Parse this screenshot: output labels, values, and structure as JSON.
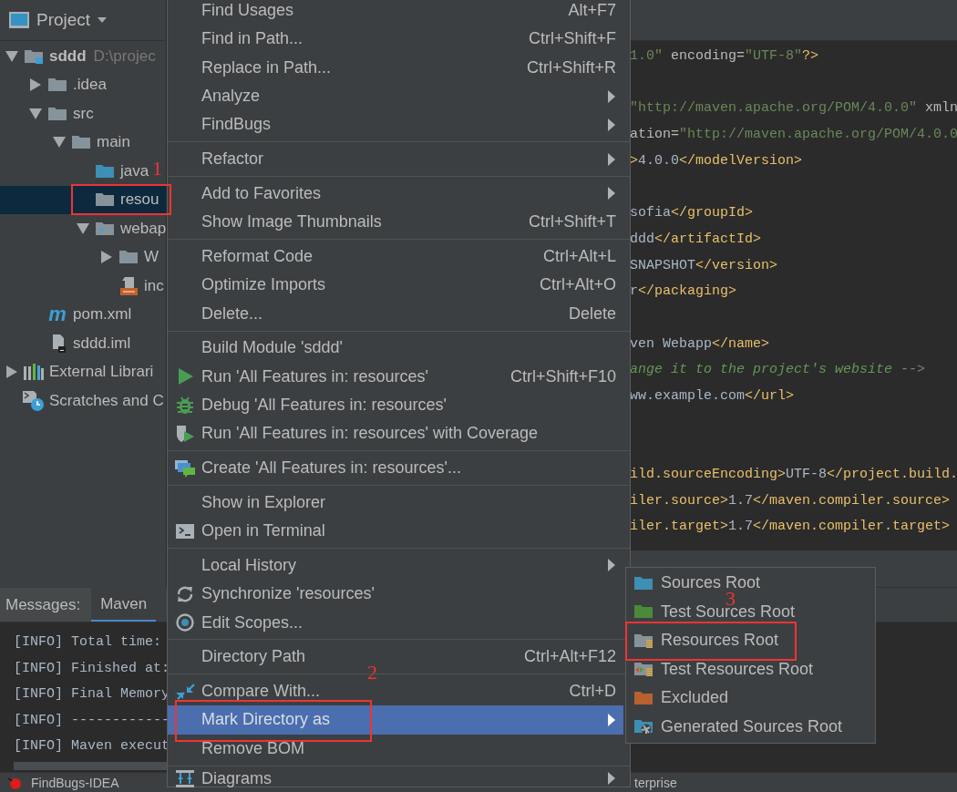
{
  "project_panel": {
    "title": "Project",
    "tree": [
      {
        "label": "sddd",
        "path": "D:\\projec",
        "kind": "module",
        "expanded": true,
        "selected": false,
        "children": [
          {
            "label": ".idea",
            "kind": "folder",
            "expanded": false,
            "selected": false
          },
          {
            "label": "src",
            "kind": "folder",
            "expanded": true,
            "selected": false,
            "children": [
              {
                "label": "main",
                "kind": "folder",
                "expanded": true,
                "selected": false,
                "children": [
                  {
                    "label": "java",
                    "kind": "source-folder",
                    "selected": false
                  },
                  {
                    "label": "resou",
                    "kind": "folder",
                    "selected": true
                  },
                  {
                    "label": "webap",
                    "kind": "web-folder",
                    "expanded": true,
                    "selected": false,
                    "children": [
                      {
                        "label": "W",
                        "kind": "folder",
                        "expanded": false,
                        "selected": false
                      },
                      {
                        "label": "inc",
                        "kind": "jsp",
                        "selected": false
                      }
                    ]
                  }
                ]
              }
            ]
          },
          {
            "label": "pom.xml",
            "kind": "maven",
            "glyph": "m",
            "selected": false
          },
          {
            "label": "sddd.iml",
            "kind": "iml",
            "selected": false
          }
        ]
      },
      {
        "label": "External Librari",
        "kind": "libraries",
        "expanded": false,
        "selected": false
      },
      {
        "label": "Scratches and C",
        "kind": "scratches",
        "selected": false
      }
    ]
  },
  "editor": {
    "lines": [
      {
        "kind": "code",
        "segments": [
          {
            "kind": "string",
            "text": "1.0\""
          },
          {
            "kind": "attr",
            "text": " encoding="
          },
          {
            "kind": "string",
            "text": "\"UTF-8\""
          },
          {
            "kind": "tag",
            "text": "?>"
          }
        ]
      },
      {
        "kind": "blank"
      },
      {
        "kind": "code",
        "segments": [
          {
            "kind": "string",
            "text": "\"http://maven.apache.org/POM/4.0.0\""
          },
          {
            "kind": "attr",
            "text": " xmln"
          }
        ]
      },
      {
        "kind": "code",
        "segments": [
          {
            "kind": "attr",
            "text": "ation="
          },
          {
            "kind": "string",
            "text": "\"http://maven.apache.org/POM/4.0.0"
          }
        ]
      },
      {
        "kind": "code",
        "segments": [
          {
            "kind": "tag",
            "text": ">"
          },
          {
            "kind": "text",
            "text": "4.0.0"
          },
          {
            "kind": "tag",
            "text": "</modelVersion>"
          }
        ]
      },
      {
        "kind": "blank"
      },
      {
        "kind": "code",
        "segments": [
          {
            "kind": "text",
            "text": "sofia"
          },
          {
            "kind": "tag",
            "text": "</groupId>"
          }
        ]
      },
      {
        "kind": "code",
        "segments": [
          {
            "kind": "text",
            "text": "ddd"
          },
          {
            "kind": "tag",
            "text": "</artifactId>"
          }
        ]
      },
      {
        "kind": "code",
        "segments": [
          {
            "kind": "text",
            "text": "SNAPSHOT"
          },
          {
            "kind": "tag",
            "text": "</version>"
          }
        ]
      },
      {
        "kind": "code",
        "segments": [
          {
            "kind": "text",
            "text": "r"
          },
          {
            "kind": "tag",
            "text": "</packaging>"
          }
        ]
      },
      {
        "kind": "blank"
      },
      {
        "kind": "code",
        "segments": [
          {
            "kind": "text",
            "text": "ven Webapp"
          },
          {
            "kind": "tag",
            "text": "</name>"
          }
        ]
      },
      {
        "kind": "code",
        "segments": [
          {
            "kind": "comment",
            "text": "ange it to the project's website"
          },
          {
            "kind": "punct",
            "text": " -->"
          }
        ]
      },
      {
        "kind": "code",
        "segments": [
          {
            "kind": "text",
            "text": "ww.example.com"
          },
          {
            "kind": "tag",
            "text": "</url>"
          }
        ]
      },
      {
        "kind": "blank"
      },
      {
        "kind": "blank"
      },
      {
        "kind": "code",
        "segments": [
          {
            "kind": "tag",
            "text": "ild.sourceEncoding>"
          },
          {
            "kind": "text",
            "text": "UTF-8"
          },
          {
            "kind": "tag",
            "text": "</project.build."
          }
        ]
      },
      {
        "kind": "code",
        "segments": [
          {
            "kind": "tag",
            "text": "iler.source>"
          },
          {
            "kind": "text",
            "text": "1.7"
          },
          {
            "kind": "tag",
            "text": "</maven.compiler.source>"
          }
        ]
      },
      {
        "kind": "code",
        "segments": [
          {
            "kind": "tag",
            "text": "iler.target>"
          },
          {
            "kind": "text",
            "text": "1.7"
          },
          {
            "kind": "tag",
            "text": "</maven.compiler.target>"
          }
        ]
      }
    ]
  },
  "tool_window": {
    "title": "Messages:",
    "tabs": [
      {
        "label": "Maven",
        "selected": true
      }
    ],
    "log": [
      "[INFO] Total time:",
      "[INFO] Finished at:",
      "[INFO] Final Memory",
      "[INFO] ------------",
      "[INFO] Maven execut"
    ]
  },
  "status_bar": {
    "left": "FindBugs-IDEA",
    "right": "terprise"
  },
  "context_menu": {
    "items": [
      {
        "kind": "item",
        "label": "Find Usages",
        "shortcut": "Alt+F7",
        "selected": false
      },
      {
        "kind": "item",
        "label": "Find in Path...",
        "shortcut": "Ctrl+Shift+F",
        "selected": false
      },
      {
        "kind": "item",
        "label": "Replace in Path...",
        "shortcut": "Ctrl+Shift+R",
        "selected": false
      },
      {
        "kind": "item",
        "label": "Analyze",
        "submenu": true,
        "selected": false
      },
      {
        "kind": "item",
        "label": "FindBugs",
        "submenu": true,
        "selected": false
      },
      {
        "kind": "separator"
      },
      {
        "kind": "item",
        "label": "Refactor",
        "submenu": true,
        "selected": false
      },
      {
        "kind": "separator"
      },
      {
        "kind": "item",
        "label": "Add to Favorites",
        "submenu": true,
        "selected": false
      },
      {
        "kind": "item",
        "label": "Show Image Thumbnails",
        "shortcut": "Ctrl+Shift+T",
        "selected": false
      },
      {
        "kind": "separator"
      },
      {
        "kind": "item",
        "label": "Reformat Code",
        "shortcut": "Ctrl+Alt+L",
        "selected": false
      },
      {
        "kind": "item",
        "label": "Optimize Imports",
        "shortcut": "Ctrl+Alt+O",
        "selected": false
      },
      {
        "kind": "item",
        "label": "Delete...",
        "shortcut": "Delete",
        "selected": false
      },
      {
        "kind": "separator"
      },
      {
        "kind": "item",
        "label": "Build Module 'sddd'",
        "selected": false
      },
      {
        "kind": "run",
        "label": "Run 'All Features in: resources'",
        "shortcut": "Ctrl+Shift+F10",
        "selected": false
      },
      {
        "kind": "debug",
        "label": "Debug 'All Features in: resources'",
        "selected": false
      },
      {
        "kind": "coverage",
        "label": "Run 'All Features in: resources' with Coverage",
        "selected": false
      },
      {
        "kind": "separator"
      },
      {
        "kind": "create",
        "label": "Create 'All Features in: resources'...",
        "selected": false
      },
      {
        "kind": "separator"
      },
      {
        "kind": "item",
        "label": "Show in Explorer",
        "selected": false
      },
      {
        "kind": "terminal",
        "label": "Open in Terminal",
        "selected": false
      },
      {
        "kind": "separator"
      },
      {
        "kind": "item",
        "label": "Local History",
        "submenu": true,
        "selected": false
      },
      {
        "kind": "sync",
        "label": "Synchronize 'resources'",
        "selected": false
      },
      {
        "kind": "scopes",
        "label": "Edit Scopes...",
        "selected": false
      },
      {
        "kind": "separator"
      },
      {
        "kind": "item",
        "label": "Directory Path",
        "shortcut": "Ctrl+Alt+F12",
        "selected": false
      },
      {
        "kind": "separator"
      },
      {
        "kind": "compare",
        "label": "Compare With...",
        "shortcut": "Ctrl+D",
        "selected": false
      },
      {
        "kind": "item",
        "label": "Mark Directory as",
        "submenu": true,
        "selected": true
      },
      {
        "kind": "item",
        "label": "Remove BOM",
        "selected": false
      },
      {
        "kind": "separator"
      },
      {
        "kind": "diagrams",
        "label": "Diagrams",
        "submenu": true,
        "selected": false
      }
    ]
  },
  "submenu": {
    "items": [
      {
        "kind": "sources",
        "label": "Sources Root"
      },
      {
        "kind": "test-sources",
        "label": "Test Sources Root"
      },
      {
        "kind": "resources",
        "label": "Resources Root"
      },
      {
        "kind": "test-resources",
        "label": "Test Resources Root"
      },
      {
        "kind": "excluded",
        "label": "Excluded"
      },
      {
        "kind": "generated",
        "label": "Generated Sources Root"
      }
    ]
  },
  "annotations": [
    {
      "label": "1"
    },
    {
      "label": "2"
    },
    {
      "label": "3"
    }
  ]
}
